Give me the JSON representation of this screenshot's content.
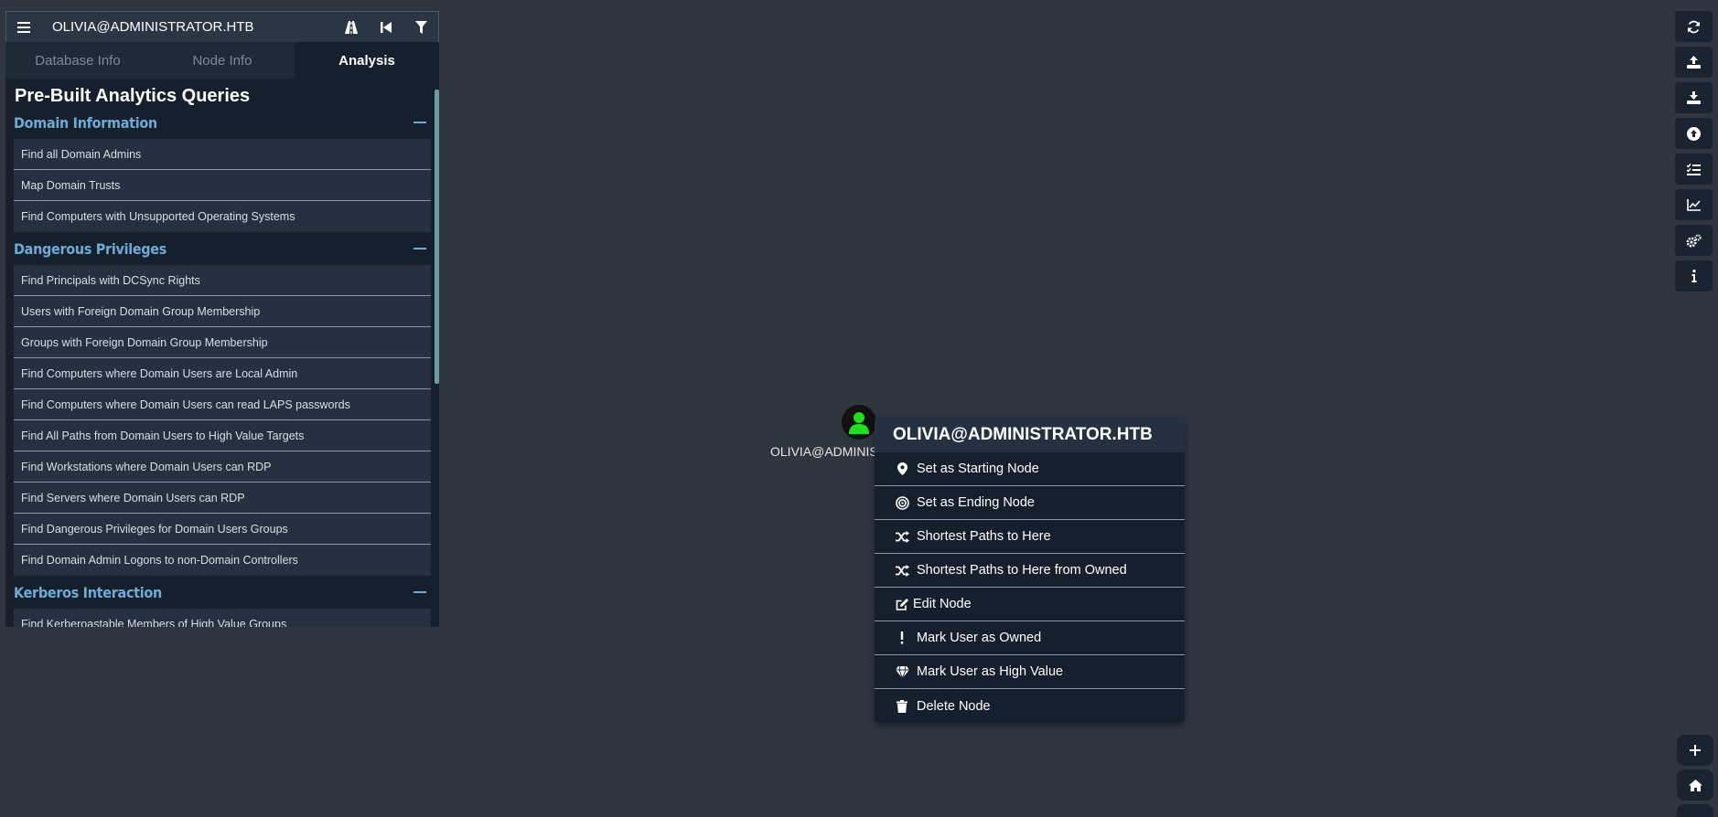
{
  "search": {
    "value": "OLIVIA@ADMINISTRATOR.HTB"
  },
  "tabs": [
    {
      "label": "Database Info"
    },
    {
      "label": "Node Info"
    },
    {
      "label": "Analysis"
    }
  ],
  "analytics": {
    "title": "Pre-Built Analytics Queries",
    "sections": [
      {
        "title": "Domain Information",
        "queries": [
          "Find all Domain Admins",
          "Map Domain Trusts",
          "Find Computers with Unsupported Operating Systems"
        ]
      },
      {
        "title": "Dangerous Privileges",
        "queries": [
          "Find Principals with DCSync Rights",
          "Users with Foreign Domain Group Membership",
          "Groups with Foreign Domain Group Membership",
          "Find Computers where Domain Users are Local Admin",
          "Find Computers where Domain Users can read LAPS passwords",
          "Find All Paths from Domain Users to High Value Targets",
          "Find Workstations where Domain Users can RDP",
          "Find Servers where Domain Users can RDP",
          "Find Dangerous Privileges for Domain Users Groups",
          "Find Domain Admin Logons to non-Domain Controllers"
        ]
      },
      {
        "title": "Kerberos Interaction",
        "queries": [
          "Find Kerberoastable Members of High Value Groups"
        ]
      }
    ]
  },
  "node": {
    "label": "OLIVIA@ADMINISTRATOR.HTB",
    "icon_color": "#22dd22"
  },
  "context_menu": {
    "title": "OLIVIA@ADMINISTRATOR.HTB",
    "items": [
      {
        "label": "Set as Starting Node",
        "icon": "map-marker-icon"
      },
      {
        "label": "Set as Ending Node",
        "icon": "bullseye-icon"
      },
      {
        "label": "Shortest Paths to Here",
        "icon": "shuffle-icon"
      },
      {
        "label": "Shortest Paths to Here from Owned",
        "icon": "shuffle-icon"
      },
      {
        "label": "Edit Node",
        "icon": "edit-icon"
      },
      {
        "label": "Mark User as Owned",
        "icon": "exclamation-icon"
      },
      {
        "label": "Mark User as High Value",
        "icon": "gem-icon"
      },
      {
        "label": "Delete Node",
        "icon": "trash-icon"
      }
    ]
  },
  "right_toolbar": [
    "refresh-icon",
    "upload-icon",
    "download-icon",
    "import-icon",
    "tasks-icon",
    "chart-icon",
    "settings-icon",
    "info-icon"
  ]
}
